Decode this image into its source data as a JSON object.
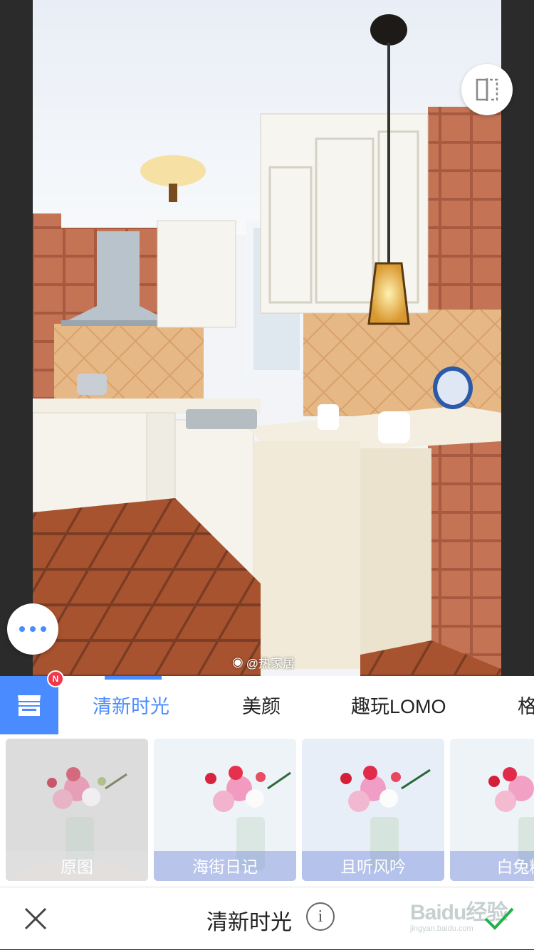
{
  "photo": {
    "watermark": "@热家居",
    "watermark_icon": "weibo-icon"
  },
  "controls": {
    "compare_icon": "compare-icon",
    "more_icon": "more-icon"
  },
  "panel": {
    "store_badge": "N",
    "tabs": [
      "清新时光",
      "美颜",
      "趣玩LOMO",
      "格"
    ],
    "active_tab": 0,
    "filters": [
      {
        "label": "原图"
      },
      {
        "label": "海街日记"
      },
      {
        "label": "且听风吟"
      },
      {
        "label": "白兔糖"
      }
    ]
  },
  "bottom": {
    "title": "清新时光",
    "info_symbol": "i",
    "overlay_wm": {
      "brand": "Baidu经验",
      "url": "jingyan.baidu.com"
    }
  },
  "colors": {
    "accent": "#4a8cff",
    "badge": "#f0384a",
    "confirm": "#22b14c"
  }
}
